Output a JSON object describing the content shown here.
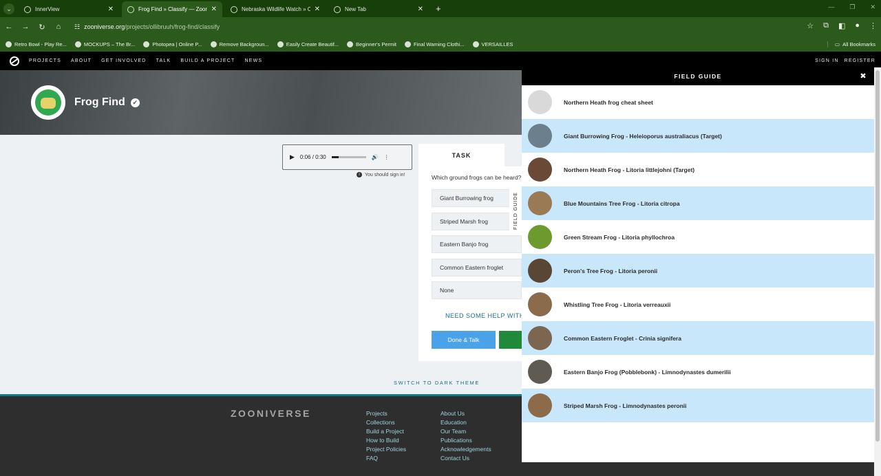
{
  "browser": {
    "tabs": [
      {
        "title": "InnerView",
        "active": false
      },
      {
        "title": "Frog Find » Classify — Zooniverse",
        "active": true
      },
      {
        "title": "Nebraska Wildlife Watch » Classify",
        "active": false
      },
      {
        "title": "New Tab",
        "active": false
      }
    ],
    "url_host": "zooniverse.org",
    "url_path": "/projects/ollibruuh/frog-find/classify",
    "bookmarks": [
      "Retro Bowl - Play Re...",
      "MOCKUPS – The Br...",
      "Photopea | Online P...",
      "Remove Backgroun...",
      "Easily Create Beautif...",
      "Beginner's Permit",
      "Final Warning Clothi...",
      "VERSAILLES"
    ],
    "all_bookmarks": "All Bookmarks"
  },
  "site_nav": {
    "links": [
      "PROJECTS",
      "ABOUT",
      "GET INVOLVED",
      "TALK",
      "BUILD A PROJECT",
      "NEWS"
    ],
    "sign_in": "SIGN IN",
    "register": "REGISTER"
  },
  "project": {
    "title": "Frog Find"
  },
  "audio": {
    "time": "0:06 / 0:30"
  },
  "signin_note": "You should sign in!",
  "task": {
    "tab_label": "TASK",
    "question": "Which ground frogs can be heard?",
    "answers": [
      "Giant Burrowing frog",
      "Striped Marsh frog",
      "Eastern Banjo frog",
      "Common Eastern froglet",
      "None"
    ],
    "need_help": "NEED SOME HELP WITH THIS TASK?",
    "done_talk": "Done & Talk"
  },
  "field_guide_tab": "FIELD GUIDE",
  "dark_theme": "SWITCH TO DARK THEME",
  "footer": {
    "logo": "ZOONIVERSE",
    "col1": [
      "Projects",
      "Collections",
      "Build a Project",
      "How to Build",
      "Project Policies",
      "FAQ"
    ],
    "col2": [
      "About Us",
      "Education",
      "Our Team",
      "Publications",
      "Acknowledgements",
      "Contact Us"
    ]
  },
  "field_guide": {
    "title": "FIELD GUIDE",
    "items": [
      {
        "label": "Northern Heath frog cheat sheet",
        "thumb": "#d9d9d9"
      },
      {
        "label": "Giant Burrowing Frog - Heleioporus australiacus (Target)",
        "thumb": "#6b7f8c"
      },
      {
        "label": "Northern Heath Frog - Litoria littlejohni (Target)",
        "thumb": "#6a4a36"
      },
      {
        "label": "Blue Mountains Tree Frog - Litoria citropa",
        "thumb": "#9a7a55"
      },
      {
        "label": "Green Stream Frog - Litoria phyllochroa",
        "thumb": "#6d9a2e"
      },
      {
        "label": "Peron's Tree Frog - Litoria peronii",
        "thumb": "#5a4634"
      },
      {
        "label": "Whistling Tree Frog - Litoria verreauxii",
        "thumb": "#8a6b4c"
      },
      {
        "label": "Common Eastern Froglet - Crinia signifera",
        "thumb": "#7d6650"
      },
      {
        "label": "Eastern Banjo Frog (Pobblebonk) - Limnodynastes dumerilii",
        "thumb": "#5f5a52"
      },
      {
        "label": "Striped Marsh Frog - Limnodynastes peronii",
        "thumb": "#8c6a4a"
      }
    ]
  }
}
